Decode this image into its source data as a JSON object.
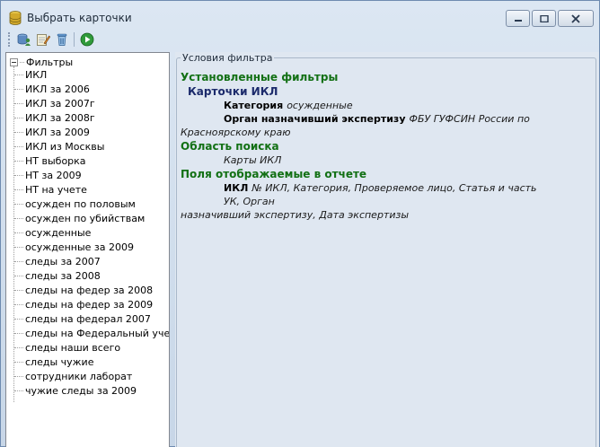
{
  "window": {
    "title": "Выбрать карточки",
    "buttons": [
      "minimize",
      "maximize",
      "close"
    ]
  },
  "toolbar": {
    "icons": [
      "database-user-icon",
      "edit-card-icon",
      "delete-icon",
      "run-icon"
    ]
  },
  "tree": {
    "root": "Фильтры",
    "items": [
      "ИКЛ",
      "ИКЛ за 2006",
      "ИКЛ за 2007г",
      "ИКЛ за 2008г",
      "ИКЛ за 2009",
      "ИКЛ из Москвы",
      "НТ выборка",
      "НТ за 2009",
      "НТ на учете",
      "осужден по половым",
      "осужден по убийствам",
      "осужденные",
      "осужденные за 2009",
      "следы за 2007",
      "следы за 2008",
      "следы на федер за 2008",
      "следы на федер за 2009",
      "следы на федерал 2007",
      "следы на Федеральный уче",
      "следы наши всего",
      "следы чужие",
      "сотрудники лаборат",
      "чужие следы за 2009"
    ]
  },
  "filter": {
    "legend": "Условия фильтра",
    "installed_header": "Установленные фильтры",
    "cards_header": "Карточки ИКЛ",
    "category_label": "Категория",
    "category_value": "осужденные",
    "organ_label": "Орган назначивший экспертизу",
    "organ_value_line1": "ФБУ ГУФСИН России по",
    "organ_value_line2": "Красноярскому краю",
    "search_header": "Область поиска",
    "search_value": "Карты ИКЛ",
    "fields_header": "Поля отображаемые в отчете",
    "fields_label": "ИКЛ",
    "fields_value_line1": "№ ИКЛ, Категория, Проверяемое лицо, Статья и часть УК, Орган",
    "fields_value_line2": "назначивший экспертизу, Дата экспертизы"
  }
}
